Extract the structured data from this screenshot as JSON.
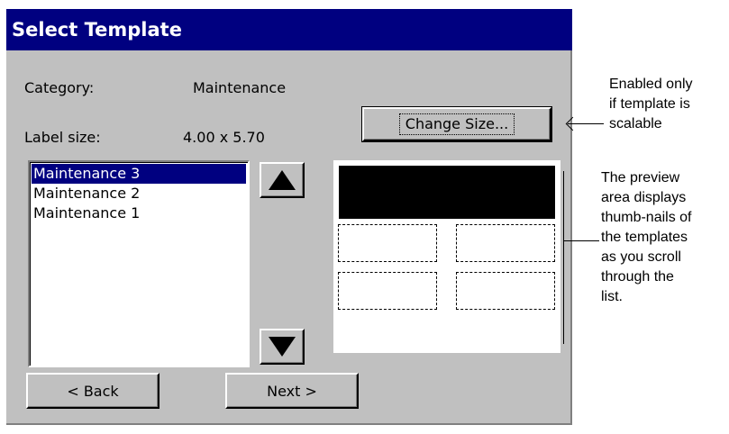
{
  "window": {
    "title": "Select Template"
  },
  "fields": {
    "category_label": "Category:",
    "category_value": "Maintenance",
    "label_size_label": "Label size:",
    "label_size_value": "4.00 x 5.70"
  },
  "buttons": {
    "change_size": "Change Size...",
    "back": "< Back",
    "next": "Next >"
  },
  "template_list": {
    "items": [
      "Maintenance 3",
      "Maintenance 2",
      "Maintenance 1"
    ],
    "selected_index": 0
  },
  "icons": {
    "scroll_up": "up-triangle-icon",
    "scroll_down": "down-triangle-icon"
  },
  "annotations": {
    "change_size_note_lines": [
      "Enabled only",
      "if template is",
      "scalable"
    ],
    "preview_note_lines": [
      "The preview",
      "area displays",
      "thumb-nails of",
      "the templates",
      "as you scroll",
      "through the",
      "list."
    ]
  },
  "colors": {
    "titlebar": "#000080",
    "dialog_bg": "#c0c0c0",
    "selection": "#000080"
  }
}
